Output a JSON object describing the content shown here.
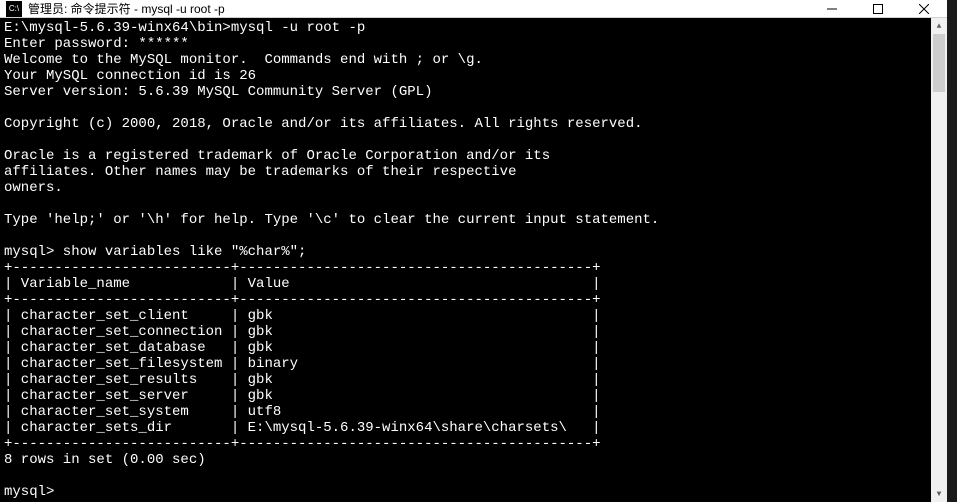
{
  "titlebar": {
    "icon_text": "C:\\",
    "title": "管理员: 命令提示符 - mysql  -u root -p"
  },
  "terminal": {
    "prompt_path": "E:\\mysql-5.6.39-winx64\\bin>",
    "command": "mysql -u root -p",
    "password_prompt": "Enter password: ",
    "password_mask": "******",
    "welcome1": "Welcome to the MySQL monitor.  Commands end with ; or \\g.",
    "welcome2": "Your MySQL connection id is 26",
    "welcome3": "Server version: 5.6.39 MySQL Community Server (GPL)",
    "copyright": "Copyright (c) 2000, 2018, Oracle and/or its affiliates. All rights reserved.",
    "trademark1": "Oracle is a registered trademark of Oracle Corporation and/or its",
    "trademark2": "affiliates. Other names may be trademarks of their respective",
    "trademark3": "owners.",
    "help_line": "Type 'help;' or '\\h' for help. Type '\\c' to clear the current input statement.",
    "mysql_prompt": "mysql> ",
    "query": "show variables like \"%char%\";",
    "table_header_var": "Variable_name",
    "table_header_val": "Value",
    "rows": [
      {
        "var": "character_set_client",
        "val": "gbk"
      },
      {
        "var": "character_set_connection",
        "val": "gbk"
      },
      {
        "var": "character_set_database",
        "val": "gbk"
      },
      {
        "var": "character_set_filesystem",
        "val": "binary"
      },
      {
        "var": "character_set_results",
        "val": "gbk"
      },
      {
        "var": "character_set_server",
        "val": "gbk"
      },
      {
        "var": "character_set_system",
        "val": "utf8"
      },
      {
        "var": "character_sets_dir",
        "val": "E:\\mysql-5.6.39-winx64\\share\\charsets\\"
      }
    ],
    "result_summary": "8 rows in set (0.00 sec)",
    "final_prompt": "mysql> "
  }
}
